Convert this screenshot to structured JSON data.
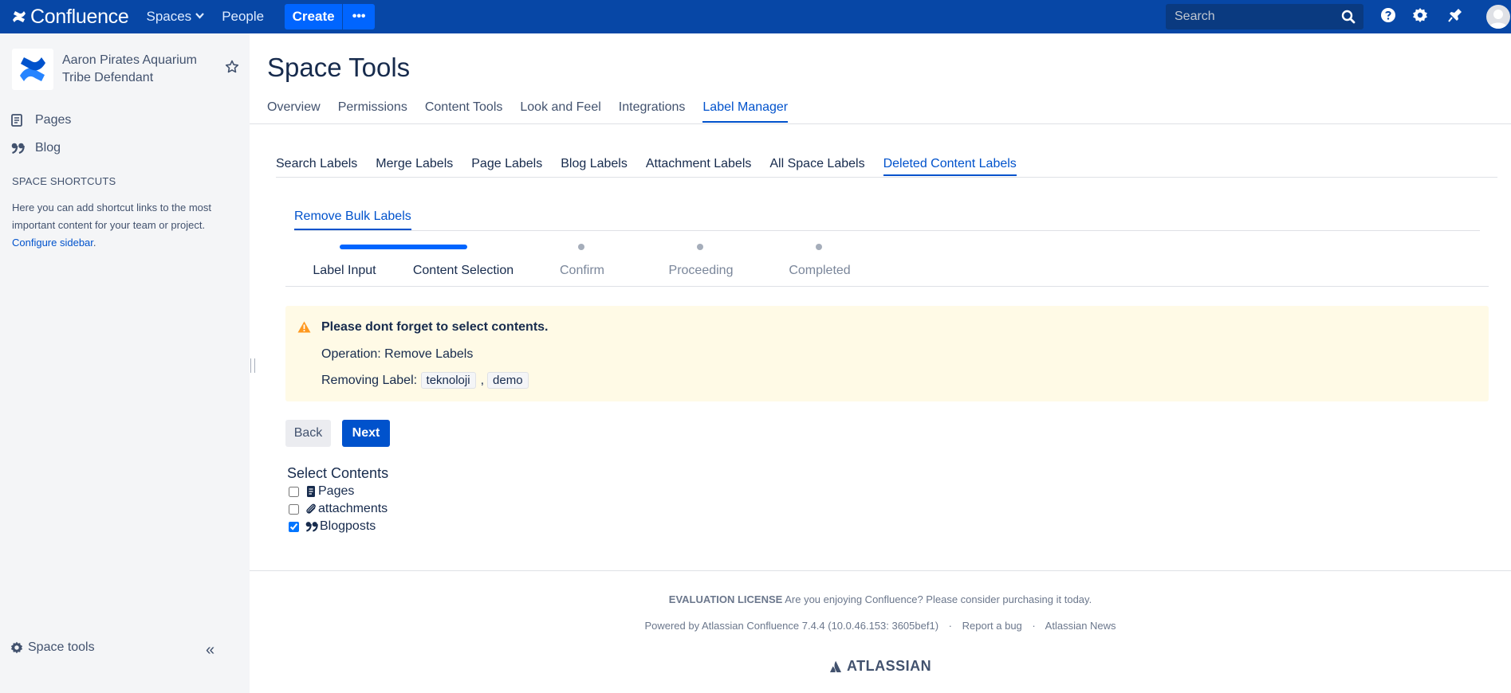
{
  "topnav": {
    "product_name": "Confluence",
    "spaces_label": "Spaces",
    "people_label": "People",
    "create_label": "Create",
    "more_label": "•••",
    "search_placeholder": "Search",
    "icons": [
      "confluence-logo-icon",
      "chevron-down-icon",
      "search-icon",
      "help-icon",
      "gear-icon",
      "notification-icon",
      "avatar"
    ]
  },
  "sidebar": {
    "space_name": "Aaron Pirates Aquarium Tribe Defendant",
    "items": [
      {
        "label": "Pages",
        "icon": "pages-icon"
      },
      {
        "label": "Blog",
        "icon": "blog-quote-icon"
      }
    ],
    "shortcuts_title": "SPACE SHORTCUTS",
    "shortcuts_text": "Here you can add shortcut links to the most important content for your team or project.",
    "configure_link": "Configure sidebar",
    "configure_suffix": ".",
    "space_tools": "Space tools",
    "collapse_label": "«"
  },
  "main": {
    "title": "Space Tools",
    "tabs": [
      {
        "label": "Overview",
        "active": false
      },
      {
        "label": "Permissions",
        "active": false
      },
      {
        "label": "Content Tools",
        "active": false
      },
      {
        "label": "Look and Feel",
        "active": false
      },
      {
        "label": "Integrations",
        "active": false
      },
      {
        "label": "Label Manager",
        "active": true
      }
    ],
    "subtabs": [
      {
        "label": "Search Labels",
        "active": false
      },
      {
        "label": "Merge Labels",
        "active": false
      },
      {
        "label": "Page Labels",
        "active": false
      },
      {
        "label": "Blog Labels",
        "active": false
      },
      {
        "label": "Attachment Labels",
        "active": false
      },
      {
        "label": "All Space Labels",
        "active": false
      },
      {
        "label": "Deleted Content Labels",
        "active": true
      }
    ],
    "inner_tab": "Remove Bulk Labels",
    "wizard": {
      "steps": [
        "Label Input",
        "Content Selection",
        "Confirm",
        "Proceeding",
        "Completed"
      ],
      "current_step": 2
    },
    "warning": {
      "title": "Please dont forget to select contents.",
      "operation": "Operation: Remove Labels",
      "removing_prefix": "Removing Label:",
      "labels": [
        "teknoloji",
        "demo"
      ],
      "separator": ","
    },
    "buttons": {
      "back": "Back",
      "next": "Next"
    },
    "select_contents": {
      "title": "Select Contents",
      "options": [
        {
          "label": "Pages",
          "icon": "page-icon",
          "checked": false
        },
        {
          "label": "attachments",
          "icon": "paperclip-icon",
          "checked": false
        },
        {
          "label": "Blogposts",
          "icon": "blog-quote-icon",
          "checked": true
        }
      ]
    }
  },
  "footer": {
    "license_bold": "EVALUATION LICENSE",
    "license_text": "Are you enjoying Confluence? Please consider purchasing it today.",
    "powered_by": "Powered by Atlassian Confluence 7.4.4 (10.0.46.153: 3605bef1)",
    "report_bug": "Report a bug",
    "atlassian_news": "Atlassian News",
    "dot": "·",
    "atlassian_logo": "ATLASSIAN"
  },
  "colors": {
    "nav_bg": "#0747a6",
    "primary": "#0052cc",
    "create_btn": "#0065ff",
    "warning_bg": "#fffae6",
    "warning_icon": "#ff991f",
    "sidebar_bg": "#f4f5f7"
  }
}
